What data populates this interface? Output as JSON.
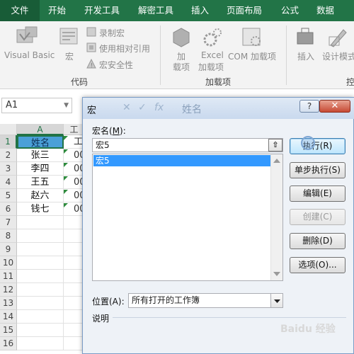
{
  "ribbon": {
    "tabs": [
      "文件",
      "开始",
      "开发工具",
      "解密工具",
      "插入",
      "页面布局",
      "公式",
      "数据"
    ],
    "code_group": {
      "visual_basic": "Visual Basic",
      "macro": "宏",
      "record_macro": "录制宏",
      "use_relative": "使用相对引用",
      "macro_security": "宏安全性",
      "label": "代码"
    },
    "addins_group": {
      "addins_line1": "加",
      "addins_line2": "载项",
      "excel_line1": "Excel",
      "excel_line2": "加载项",
      "com_addins": "COM 加载项",
      "label": "加载项"
    },
    "controls_group": {
      "insert": "插入",
      "design_mode": "设计模式",
      "label": "控"
    }
  },
  "formula_bar": {
    "name_box": "A1",
    "content": "姓名"
  },
  "sheet": {
    "columns": [
      "A",
      "工"
    ],
    "rows": [
      {
        "num": "1",
        "a": "姓名",
        "b": "工"
      },
      {
        "num": "2",
        "a": "张三",
        "b": "00"
      },
      {
        "num": "3",
        "a": "李四",
        "b": "00"
      },
      {
        "num": "4",
        "a": "王五",
        "b": "00"
      },
      {
        "num": "5",
        "a": "赵六",
        "b": "00"
      },
      {
        "num": "6",
        "a": "钱七",
        "b": "00"
      },
      {
        "num": "7",
        "a": "",
        "b": ""
      },
      {
        "num": "8",
        "a": "",
        "b": ""
      },
      {
        "num": "9",
        "a": "",
        "b": ""
      },
      {
        "num": "10",
        "a": "",
        "b": ""
      },
      {
        "num": "11",
        "a": "",
        "b": ""
      },
      {
        "num": "12",
        "a": "",
        "b": ""
      },
      {
        "num": "13",
        "a": "",
        "b": ""
      },
      {
        "num": "14",
        "a": "",
        "b": ""
      },
      {
        "num": "15",
        "a": "",
        "b": ""
      },
      {
        "num": "16",
        "a": "",
        "b": ""
      }
    ]
  },
  "dialog": {
    "title": "宏",
    "help": "?",
    "close": "✕",
    "macro_name_label": "宏名(",
    "macro_name_key": "M",
    "macro_name_label_end": "):",
    "macro_name_value": "宏5",
    "list_items": [
      "宏5"
    ],
    "buttons": {
      "run": "执行(R)",
      "step_into": "单步执行(S)",
      "edit": "编辑(E)",
      "create": "创建(C)",
      "delete": "删除(D)",
      "options": "选项(O)..."
    },
    "location_label": "位置(A):",
    "location_value": "所有打开的工作簿",
    "description_label": "说明"
  },
  "watermark": "Baidu 经验",
  "colors": {
    "ribbon_green": "#227447",
    "selection_blue": "#3399ff",
    "excel_green": "#217346"
  }
}
